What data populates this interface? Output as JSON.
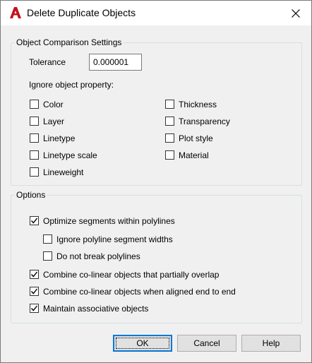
{
  "window": {
    "title": "Delete Duplicate Objects",
    "app_icon": "autocad-a-icon",
    "close_icon": "close-x-icon"
  },
  "comparison": {
    "group_label": "Object Comparison Settings",
    "tolerance_label": "Tolerance",
    "tolerance_value": "0.000001",
    "ignore_label": "Ignore object property:",
    "properties_left": [
      {
        "label": "Color",
        "checked": false
      },
      {
        "label": "Layer",
        "checked": false
      },
      {
        "label": "Linetype",
        "checked": false
      },
      {
        "label": "Linetype scale",
        "checked": false
      },
      {
        "label": "Lineweight",
        "checked": false
      }
    ],
    "properties_right": [
      {
        "label": "Thickness",
        "checked": false
      },
      {
        "label": "Transparency",
        "checked": false
      },
      {
        "label": "Plot style",
        "checked": false
      },
      {
        "label": "Material",
        "checked": false
      }
    ]
  },
  "options": {
    "group_label": "Options",
    "optimize": {
      "label": "Optimize segments within polylines",
      "checked": true
    },
    "ignore_widths": {
      "label": "Ignore polyline segment widths",
      "checked": false
    },
    "no_break": {
      "label": "Do not break polylines",
      "checked": false
    },
    "partial_overlap": {
      "label": "Combine co-linear objects that partially overlap",
      "checked": true
    },
    "end_to_end": {
      "label": "Combine co-linear objects when aligned end to end",
      "checked": true
    },
    "associative": {
      "label": "Maintain associative objects",
      "checked": true
    }
  },
  "buttons": {
    "ok": "OK",
    "cancel": "Cancel",
    "help": "Help"
  },
  "colors": {
    "accent": "#0078d7",
    "autocad_red": "#c1121f"
  }
}
